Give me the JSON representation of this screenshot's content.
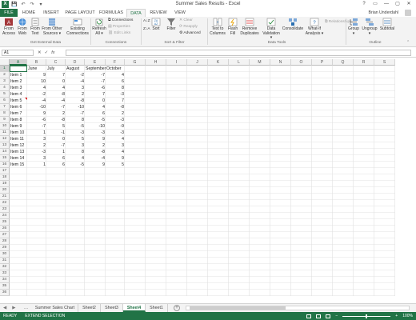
{
  "window": {
    "title": "Summer Sales Results - Excel",
    "controls": [
      "?",
      "▭",
      "—",
      "▢",
      "✕"
    ]
  },
  "qat": {
    "save": "💾",
    "undo": "↶",
    "redo": "↷",
    "more": "▾"
  },
  "tabs": [
    {
      "label": "FILE"
    },
    {
      "label": "HOME"
    },
    {
      "label": "INSERT"
    },
    {
      "label": "PAGE LAYOUT"
    },
    {
      "label": "FORMULAS"
    },
    {
      "label": "DATA"
    },
    {
      "label": "REVIEW"
    },
    {
      "label": "VIEW"
    }
  ],
  "user": {
    "name": "Brian Underdahl"
  },
  "ribbon": {
    "get_external": {
      "from_access": "From\nAccess",
      "from_web": "From\nWeb",
      "from_text": "From\nText",
      "from_other": "From Other\nSources ▾",
      "existing": "Existing\nConnections",
      "label": "Get External Data"
    },
    "connections": {
      "refresh_all": "Refresh\nAll ▾",
      "connections": "Connections",
      "properties": "Properties",
      "edit_links": "Edit Links",
      "label": "Connections"
    },
    "sort_filter": {
      "az": "A↓Z",
      "za": "Z↓A",
      "sort": "Sort",
      "filter": "Filter",
      "clear": "Clear",
      "reapply": "Reapply",
      "advanced": "Advanced",
      "label": "Sort & Filter"
    },
    "data_tools": {
      "text_to_columns": "Text to\nColumns",
      "flash_fill": "Flash\nFill",
      "remove_duplicates": "Remove\nDuplicates",
      "data_validation": "Data\nValidation ▾",
      "consolidate": "Consolidate",
      "what_if": "What-If\nAnalysis ▾",
      "relationships": "Relationships",
      "label": "Data Tools"
    },
    "outline": {
      "group": "Group\n▾",
      "ungroup": "Ungroup\n▾",
      "subtotal": "Subtotal",
      "label": "Outline"
    }
  },
  "formula_bar": {
    "name_box": "A1",
    "fx": "fx",
    "cancel": "✕",
    "enter": "✓",
    "value": ""
  },
  "columns": [
    "A",
    "B",
    "C",
    "D",
    "E",
    "F",
    "G",
    "H",
    "I",
    "J",
    "K",
    "L",
    "M",
    "N",
    "O",
    "P",
    "Q",
    "R",
    "S"
  ],
  "selected_column": "A",
  "selected_row": 1,
  "rows_shown": 36,
  "headers": [
    "",
    "June",
    "July",
    "August",
    "September",
    "October"
  ],
  "table": [
    [
      "Item 1",
      "9",
      "7",
      "-2",
      "-7",
      "4"
    ],
    [
      "Item 2",
      "10",
      "0",
      "-4",
      "-7",
      "6"
    ],
    [
      "Item 3",
      "4",
      "4",
      "3",
      "-6",
      "8"
    ],
    [
      "Item 4",
      "-2",
      "-8",
      "2",
      "7",
      "-3"
    ],
    [
      "Item 5",
      "-4",
      "-4",
      "-8",
      "0",
      "7"
    ],
    [
      "Item 6",
      "-10",
      "-7",
      "-10",
      "4",
      "-8"
    ],
    [
      "Item 7",
      "9",
      "2",
      "-7",
      "6",
      "2"
    ],
    [
      "Item 8",
      "-6",
      "-8",
      "8",
      "-5",
      "-3"
    ],
    [
      "Item 9",
      "-7",
      "5",
      "-5",
      "-10",
      "-9"
    ],
    [
      "Item 10",
      "1",
      "-1",
      "-3",
      "-3",
      "-3"
    ],
    [
      "Item 11",
      "3",
      "0",
      "5",
      "9",
      "4"
    ],
    [
      "Item 12",
      "2",
      "-7",
      "3",
      "2",
      "3"
    ],
    [
      "Item 13",
      "-3",
      "1",
      "8",
      "-8",
      "4"
    ],
    [
      "Item 14",
      "3",
      "6",
      "4",
      "-4",
      "9"
    ],
    [
      "Item 15",
      "1",
      "6",
      "-5",
      "9",
      "5"
    ]
  ],
  "sheets": [
    {
      "label": "Summer Sales Chart",
      "active": false
    },
    {
      "label": "Sheet2",
      "active": false
    },
    {
      "label": "Sheet3",
      "active": false
    },
    {
      "label": "Sheet4",
      "active": true
    },
    {
      "label": "Sheet1",
      "active": false
    }
  ],
  "sheet_nav": {
    "prev": "◀",
    "next": "▶",
    "more": "...",
    "add": "+"
  },
  "status": {
    "mode": "READY",
    "extend": "EXTEND SELECTION",
    "zoom_minus": "−",
    "zoom_plus": "+",
    "zoom": "100%"
  },
  "colors": {
    "accent": "#217346"
  }
}
